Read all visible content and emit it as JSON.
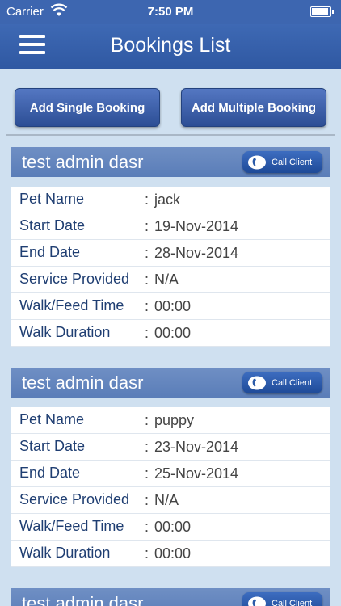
{
  "status_bar": {
    "carrier": "Carrier",
    "time": "7:50 PM"
  },
  "nav": {
    "title": "Bookings List"
  },
  "actions": {
    "single": "Add Single Booking",
    "multiple": "Add Multiple Booking"
  },
  "call_label": "Call Client",
  "bookings": [
    {
      "client": "test admin dasr",
      "fields": [
        {
          "label": "Pet Name",
          "value": "jack"
        },
        {
          "label": "Start Date",
          "value": "19-Nov-2014"
        },
        {
          "label": "End Date",
          "value": "28-Nov-2014"
        },
        {
          "label": "Service Provided",
          "value": "N/A"
        },
        {
          "label": "Walk/Feed Time",
          "value": "00:00"
        },
        {
          "label": "Walk Duration",
          "value": "00:00"
        }
      ]
    },
    {
      "client": "test admin dasr",
      "fields": [
        {
          "label": "Pet Name",
          "value": "puppy"
        },
        {
          "label": "Start Date",
          "value": "23-Nov-2014"
        },
        {
          "label": "End Date",
          "value": "25-Nov-2014"
        },
        {
          "label": "Service Provided",
          "value": "N/A"
        },
        {
          "label": "Walk/Feed Time",
          "value": "00:00"
        },
        {
          "label": "Walk Duration",
          "value": "00:00"
        }
      ]
    },
    {
      "client": "test admin dasr",
      "fields": []
    }
  ]
}
